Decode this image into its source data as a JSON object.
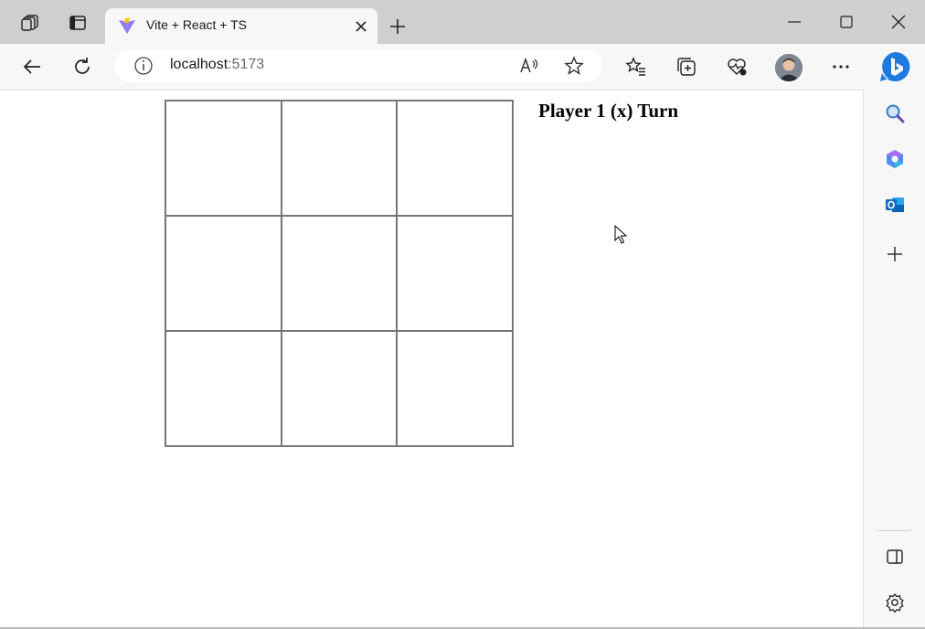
{
  "browser": {
    "tab": {
      "title": "Vite + React + TS",
      "favicon": "vite-icon"
    },
    "address": {
      "host": "localhost",
      "port": ":5173"
    },
    "icons": [
      "workspaces-icon",
      "tab-actions-icon",
      "close-tab-icon",
      "new-tab-icon",
      "minimize-icon",
      "maximize-icon",
      "close-window-icon",
      "back-icon",
      "refresh-icon",
      "info-icon",
      "read-aloud-icon",
      "favorite-star-icon",
      "favorites-icon",
      "collections-icon",
      "browser-essentials-icon",
      "profile-avatar",
      "more-icon",
      "copilot-icon"
    ],
    "sidebar_icons": [
      "search-icon",
      "copilot-sidebar-icon",
      "outlook-icon",
      "add-icon",
      "split-screen-icon",
      "settings-icon"
    ]
  },
  "game": {
    "status": "Player 1 (x) Turn",
    "cells": [
      "",
      "",
      "",
      "",
      "",
      "",
      "",
      "",
      ""
    ]
  }
}
